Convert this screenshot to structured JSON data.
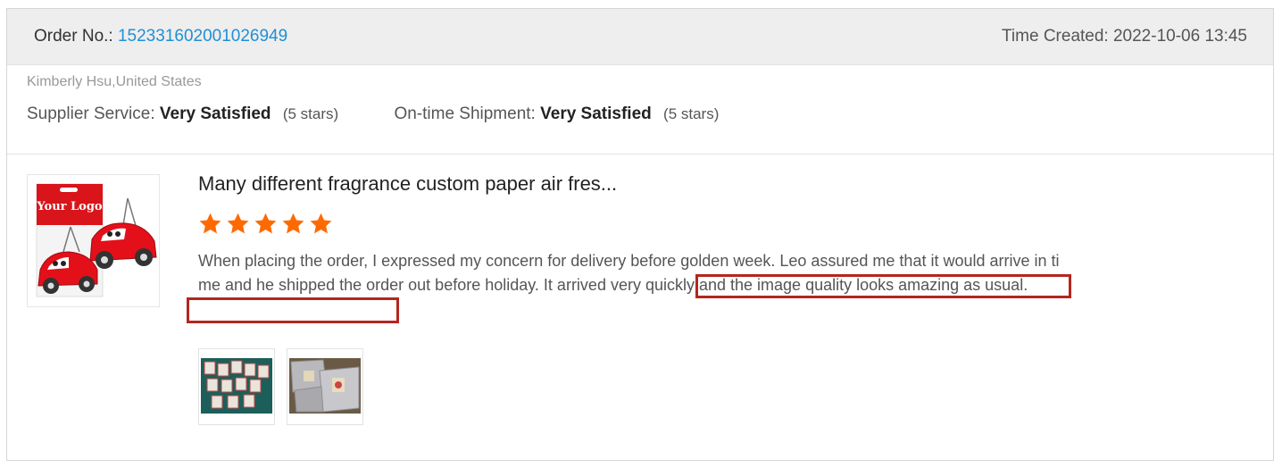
{
  "order": {
    "label": "Order No.:",
    "number": "152331602001026949",
    "time_created": "Time Created: 2022-10-06 13:45"
  },
  "buyer": "Kimberly Hsu,United States",
  "ratings": {
    "supplier_label": "Supplier Service:",
    "supplier_value": "Very Satisfied",
    "supplier_stars": "(5 stars)",
    "shipment_label": "On-time Shipment:",
    "shipment_value": "Very Satisfied",
    "shipment_stars": "(5 stars)"
  },
  "product": {
    "title": "Many different fragrance custom paper air fres...",
    "image_logo_text": "Your Logo",
    "rating": 5
  },
  "review": {
    "text": "When placing the order, I expressed my concern for delivery before golden week. Leo assured me that it would arrive in time and he shipped the order out before holiday. It arrived very quickly and the image quality looks amazing as usual."
  },
  "colors": {
    "order_number": "#1f8fd6",
    "star": "#ff6a00",
    "highlight": "#b3261e",
    "header_bg": "#eeeeee"
  }
}
